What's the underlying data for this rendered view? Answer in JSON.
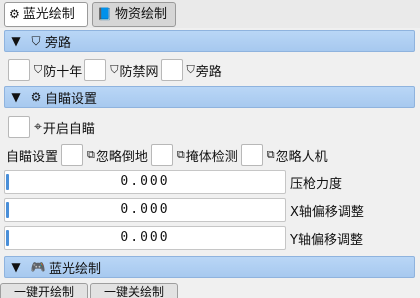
{
  "tabs": [
    {
      "icon": "gear-icon",
      "glyph": "⚙",
      "label": "蓝光绘制"
    },
    {
      "icon": "book-icon",
      "glyph": "📘",
      "label": "物资绘制"
    }
  ],
  "section_bypass": {
    "icon": "shield-icon",
    "glyph": "⛉",
    "label": "旁路"
  },
  "bypass_options": [
    {
      "icon": "shield-icon",
      "glyph": "⛉",
      "label": "防十年",
      "checked": false
    },
    {
      "icon": "shield-icon",
      "glyph": "⛉",
      "label": "防禁网",
      "checked": false
    },
    {
      "icon": "shield-icon",
      "glyph": "⛉",
      "label": "旁路",
      "checked": false
    }
  ],
  "section_aim": {
    "icon": "gear-icon",
    "glyph": "⚙",
    "label": "自瞄设置"
  },
  "aim_enable": {
    "icon": "crosshair-icon",
    "glyph": "⌖",
    "label": "开启自瞄",
    "checked": false
  },
  "aim_settings": {
    "label": "自瞄设置",
    "options": [
      {
        "icon": "copy-icon",
        "glyph": "⧉",
        "label": "忽略倒地",
        "checked": false
      },
      {
        "icon": "copy-icon",
        "glyph": "⧉",
        "label": "掩体检测",
        "checked": false
      },
      {
        "icon": "copy-icon",
        "glyph": "⧉",
        "label": "忽略人机",
        "checked": false
      }
    ]
  },
  "sliders": [
    {
      "value": "0.000",
      "label": "压枪力度"
    },
    {
      "value": "0.000",
      "label": "X轴偏移调整"
    },
    {
      "value": "0.000",
      "label": "Y轴偏移调整"
    }
  ],
  "section_draw": {
    "icon": "gamepad-icon",
    "glyph": "🎮",
    "label": "蓝光绘制"
  },
  "buttons": {
    "enable": "一键开绘制",
    "disable": "一键关绘制"
  }
}
